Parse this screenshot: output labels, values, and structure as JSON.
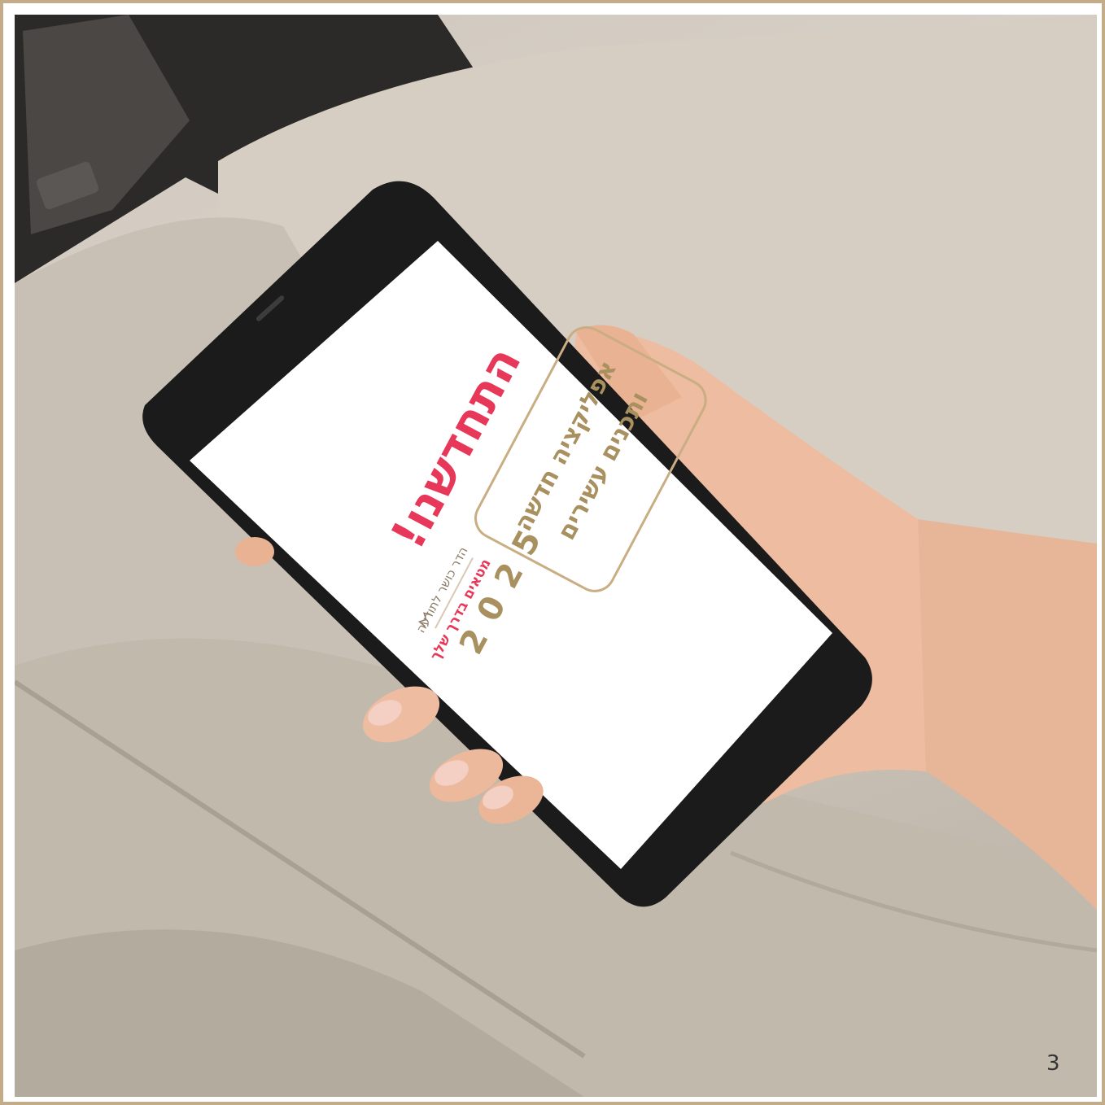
{
  "page": {
    "number": "3"
  },
  "photo": {
    "subject": "hand-holding-smartphone-in-car"
  },
  "screen": {
    "headline": "התחדשנו!",
    "box_line1": "אפליקציה חדשה",
    "box_line2": "ותכנים עשירים",
    "brand_name": "הדר כושר לתודעה",
    "tagline": "מטאים בדרך שלך",
    "year": "2025"
  },
  "colors": {
    "accent_pink": "#e8385a",
    "gold": "#a8905f",
    "frame": "#c4ab8a",
    "phone_body": "#1b1b1b"
  }
}
